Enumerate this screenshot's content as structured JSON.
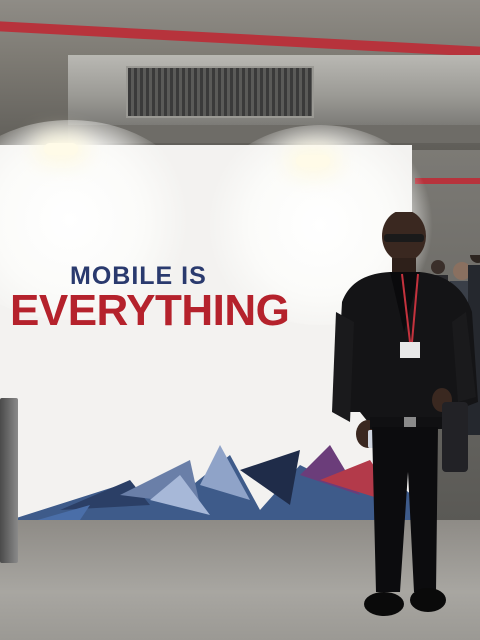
{
  "photo": {
    "banner": {
      "line1": "MOBILE IS",
      "line2": "EVERYTHING"
    },
    "colors": {
      "headline_blue": "#2a3a6e",
      "headline_red": "#b5222c",
      "banner_white": "#f3f2f0",
      "pipe_red": "#b7333c"
    }
  }
}
